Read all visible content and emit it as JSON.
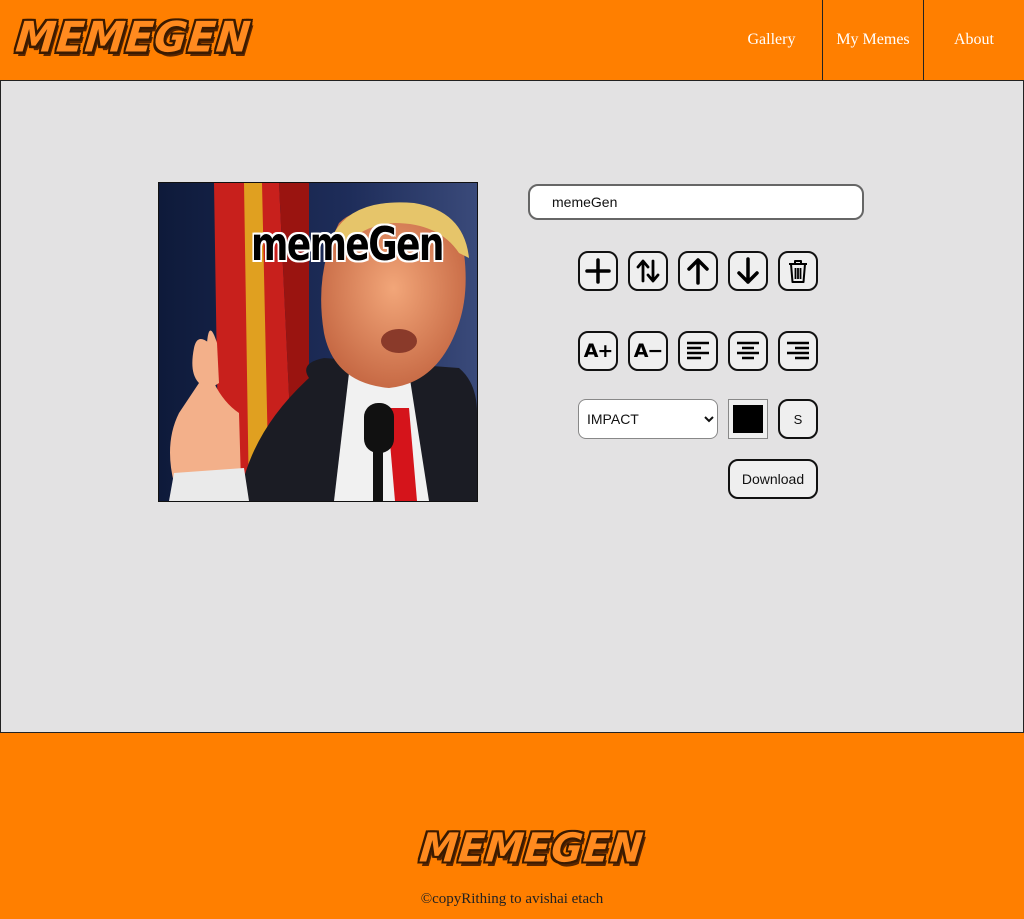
{
  "header": {
    "logo": "MEMEGEN",
    "nav": [
      "Gallery",
      "My Memes",
      "About"
    ]
  },
  "editor": {
    "meme_caption": "memeGen",
    "text_input_value": "memeGen",
    "font_select": {
      "selected": "IMPACT",
      "options": [
        "IMPACT"
      ]
    },
    "stroke_label": "S",
    "download_label": "Download",
    "color_value": "#000000"
  },
  "footer": {
    "logo": "MEMEGEN",
    "copyright": "©copyRithing to avishai etach"
  },
  "colors": {
    "brand_orange": "#ff7f00",
    "main_bg": "#e3e2e3"
  }
}
